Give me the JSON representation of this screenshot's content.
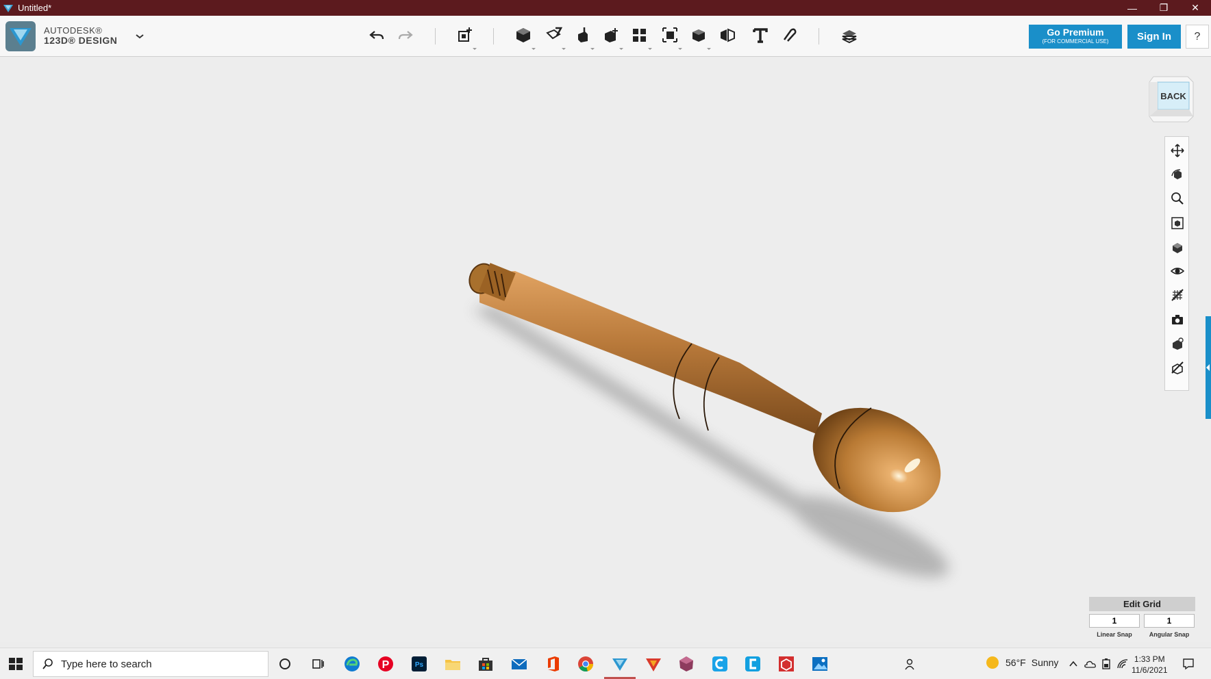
{
  "window": {
    "title": "Untitled*",
    "minimize_glyph": "—",
    "restore_glyph": "❐",
    "close_glyph": "✕"
  },
  "brand": {
    "line1": "AUTODESK®",
    "line2": "123D® DESIGN"
  },
  "toolbar": {
    "tools": [
      "undo-icon",
      "redo-icon",
      "transform-icon",
      "primitives-icon",
      "sketch-icon",
      "construct-icon",
      "modify-icon",
      "pattern-icon",
      "group-icon",
      "combine-icon",
      "measure-icon",
      "text-icon",
      "snap-icon",
      "material-icon"
    ]
  },
  "account": {
    "premium_label": "Go Premium",
    "premium_sub": "(FOR COMMERCIAL USE)",
    "signin_label": "Sign In",
    "help_label": "?"
  },
  "viewcube": {
    "face_label": "BACK"
  },
  "nav_tools": [
    "pan-icon",
    "orbit-icon",
    "zoom-icon",
    "fit-icon",
    "views-icon",
    "visibility-icon",
    "grid-toggle-icon",
    "screenshot-icon",
    "material-toggle-icon",
    "outline-toggle-icon"
  ],
  "edit_grid": {
    "title": "Edit Grid",
    "linear_snap_value": "1",
    "angular_snap_value": "1",
    "linear_snap_label": "Linear Snap",
    "angular_snap_label": "Angular Snap"
  },
  "taskbar": {
    "search_placeholder": "Type here to search",
    "weather_temp": "56°F",
    "weather_desc": "Sunny",
    "time": "1:33 PM",
    "date": "11/6/2021",
    "apps": [
      "cortana-icon",
      "task-view-icon",
      "edge-icon",
      "pinterest-icon",
      "photoshop-icon",
      "file-explorer-icon",
      "store-icon",
      "mail-icon",
      "office-icon",
      "chrome-icon",
      "123d-design-icon",
      "vectorize-icon",
      "meshmixer-icon",
      "cleanmgr-icon",
      "c-app-icon",
      "3d-builder-icon",
      "photos-icon"
    ]
  },
  "colors": {
    "titlebar": "#5c1a1e",
    "accent": "#1a8fc9",
    "model_wood": "#b8793a",
    "viewport_bg": "#ededed"
  }
}
